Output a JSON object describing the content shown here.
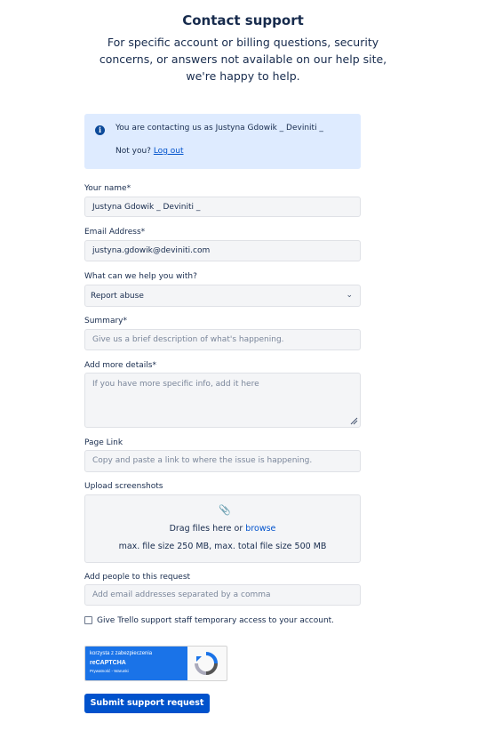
{
  "header": {
    "title": "Contact support",
    "subtitle": "For specific account or billing questions, security concerns, or answers not available on our help site, we're happy to help."
  },
  "banner": {
    "icon": "info-icon",
    "message": "You are contacting us as Justyna Gdowik _ Deviniti _",
    "not_you": "Not you?",
    "logout": "Log out"
  },
  "form": {
    "name": {
      "label": "Your name*",
      "value": "Justyna Gdowik _ Deviniti _"
    },
    "email": {
      "label": "Email Address*",
      "value": "justyna.gdowik@deviniti.com"
    },
    "help_with": {
      "label": "What can we help you with?",
      "selected": "Report abuse"
    },
    "summary": {
      "label": "Summary*",
      "placeholder": "Give us a brief description of what's happening."
    },
    "details": {
      "label": "Add more details*",
      "placeholder": "If you have more specific info, add it here"
    },
    "page_link": {
      "label": "Page Link",
      "placeholder": "Copy and paste a link to where the issue is happening."
    },
    "upload": {
      "label": "Upload screenshots",
      "drag_text": "Drag files here or",
      "browse": "browse",
      "limits": "max. file size 250 MB, max. total file size 500 MB"
    },
    "people": {
      "label": "Add people to this request",
      "placeholder": "Add email addresses separated by a comma"
    },
    "access_checkbox": {
      "label": "Give Trello support staff temporary access to your account.",
      "checked": false
    },
    "recaptcha": {
      "line1": "korzysta z zabezpieczenia",
      "line2": "reCAPTCHA",
      "line3": "Prywatność - Warunki"
    },
    "submit": "Submit support request"
  },
  "colors": {
    "accent": "#0052cc",
    "banner_bg": "#deebff",
    "field_bg": "#f4f5f7"
  }
}
